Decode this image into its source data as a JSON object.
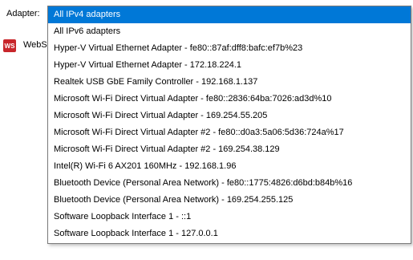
{
  "adapter_label": "Adapter:",
  "app_row": {
    "icon_text": "WS",
    "text": "WebS"
  },
  "colors": {
    "selection": "#0078d7",
    "icon_red": "#c8262b"
  },
  "dropdown": {
    "selected_index": 0,
    "options": [
      "All IPv4 adapters",
      "All IPv6 adapters",
      "Hyper-V Virtual Ethernet Adapter - fe80::87af:dff8:bafc:ef7b%23",
      "Hyper-V Virtual Ethernet Adapter - 172.18.224.1",
      "Realtek USB GbE Family Controller - 192.168.1.137",
      "Microsoft Wi-Fi Direct Virtual Adapter - fe80::2836:64ba:7026:ad3d%10",
      "Microsoft Wi-Fi Direct Virtual Adapter - 169.254.55.205",
      "Microsoft Wi-Fi Direct Virtual Adapter #2 - fe80::d0a3:5a06:5d36:724a%17",
      "Microsoft Wi-Fi Direct Virtual Adapter #2 - 169.254.38.129",
      "Intel(R) Wi-Fi 6 AX201 160MHz - 192.168.1.96",
      "Bluetooth Device (Personal Area Network) - fe80::1775:4826:d6bd:b84b%16",
      "Bluetooth Device (Personal Area Network) - 169.254.255.125",
      "Software Loopback Interface 1 - ::1",
      "Software Loopback Interface 1 - 127.0.0.1"
    ]
  }
}
